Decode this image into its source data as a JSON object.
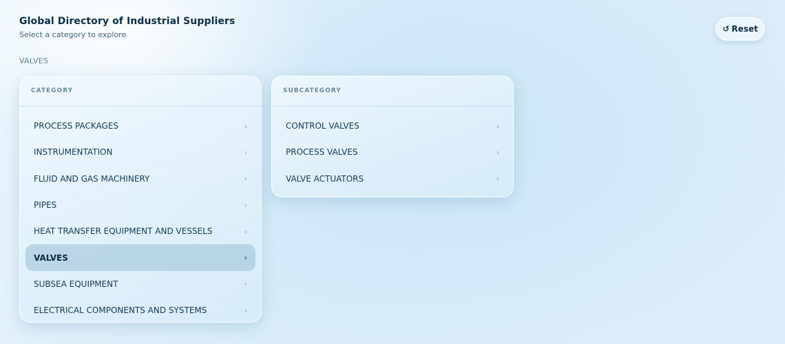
{
  "header": {
    "title": "Global Directory of Industrial Suppliers",
    "subtitle": "Select a category to explore"
  },
  "breadcrumb": "VALVES",
  "reset": {
    "icon": "↺",
    "label": "Reset"
  },
  "category_panel": {
    "heading": "CATEGORY",
    "items": [
      {
        "label": "PROCESS PACKAGES",
        "chevron": "›"
      },
      {
        "label": "INSTRUMENTATION",
        "chevron": "›"
      },
      {
        "label": "FLUID AND GAS MACHINERY",
        "chevron": "›"
      },
      {
        "label": "PIPES",
        "chevron": "›"
      },
      {
        "label": "HEAT TRANSFER EQUIPMENT AND VESSELS",
        "chevron": "›"
      },
      {
        "label": "VALVES",
        "chevron": "›",
        "selected": true
      },
      {
        "label": "SUBSEA EQUIPMENT",
        "chevron": "›"
      },
      {
        "label": "ELECTRICAL COMPONENTS AND SYSTEMS",
        "chevron": "›"
      }
    ]
  },
  "subcategory_panel": {
    "heading": "SUBCATEGORY",
    "items": [
      {
        "label": "CONTROL VALVES",
        "chevron": "›"
      },
      {
        "label": "PROCESS VALVES",
        "chevron": "›"
      },
      {
        "label": "VALVE ACTUATORS",
        "chevron": "›"
      }
    ]
  },
  "colors": {
    "text": "#0f2f45",
    "muted": "#6a8799",
    "selected_bg": "#b3d0e2"
  }
}
